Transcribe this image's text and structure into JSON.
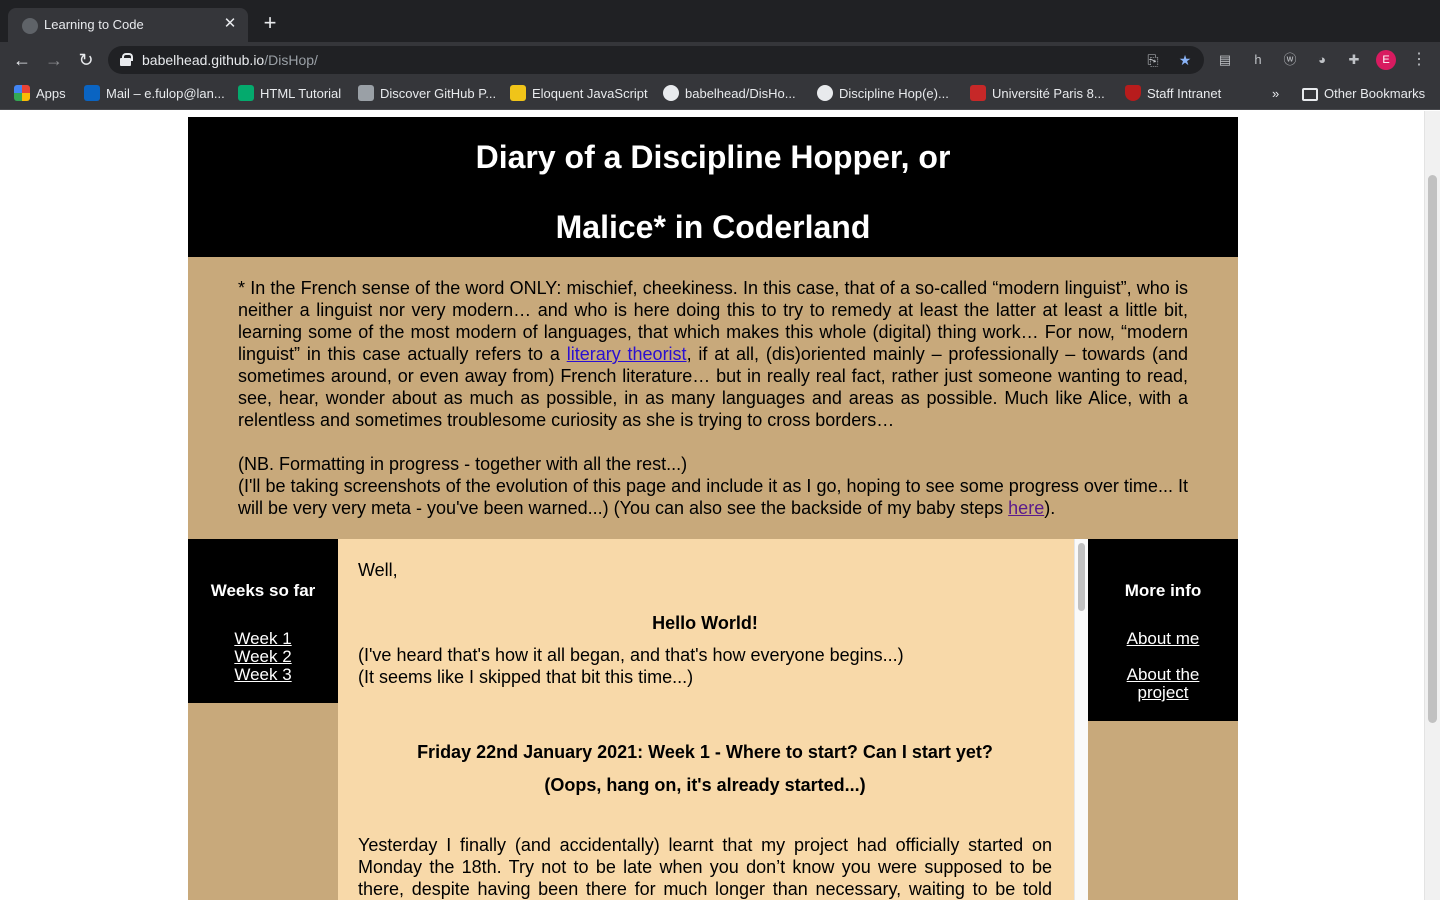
{
  "browser": {
    "tab_title": "Learning to Code",
    "url_host": "babelhead.github.io",
    "url_path": "/DisHop/",
    "profile_initial": "E",
    "bookmarks": [
      {
        "label": "Apps",
        "icon": "apps-grid-icon"
      },
      {
        "label": "Mail – e.fulop@lan...",
        "icon": "outlook-icon"
      },
      {
        "label": "HTML Tutorial",
        "icon": "w3schools-icon"
      },
      {
        "label": "Discover GitHub P...",
        "icon": "page-icon"
      },
      {
        "label": "Eloquent JavaScript",
        "icon": "ejs-icon"
      },
      {
        "label": "babelhead/DisHo...",
        "icon": "github-icon"
      },
      {
        "label": "Discipline Hop(e)...",
        "icon": "globe-icon"
      },
      {
        "label": "Université Paris 8...",
        "icon": "paris8-icon"
      },
      {
        "label": "Staff Intranet",
        "icon": "shield-crest-icon"
      }
    ],
    "overflow_label": "»",
    "other_bookmarks": "Other Bookmarks"
  },
  "site": {
    "title_line1": "Diary of a Discipline Hopper, or",
    "title_line2": "Malice* in Coderland",
    "intro": {
      "p1_before_link": "* In the French sense of the word ONLY: mischief, cheekiness. In this case, that of a so-called “modern linguist”, who is neither a linguist nor very modern… and who is here doing this to try to remedy at least the latter at least a little bit, learning some of the most modern of languages, that which makes this whole (digital) thing work… For now, “modern linguist” in this case actually refers to a ",
      "p1_link": "literary theorist",
      "p1_after_link": ", if at all, (dis)oriented mainly – professionally – towards (and sometimes around, or even away from) French literature… but in really real fact, rather just someone wanting to read, see, hear, wonder about as much as possible, in as many languages and areas as possible. Much like Alice, with a relentless and sometimes troublesome curiosity as she is trying to cross borders…",
      "nb": "(NB. Formatting in progress - together with all the rest...)",
      "p3_before_link": "(I'll be taking screenshots of the evolution of this page and include it as I go, hoping to see some progress over time... It will be very very meta - you've been warned...) (You can also see the backside of my baby steps ",
      "p3_link": "here",
      "p3_after_link": ")."
    },
    "left_nav": {
      "heading": "Weeks so far",
      "links": [
        "Week 1",
        "Week 2",
        "Week 3"
      ]
    },
    "right_nav": {
      "heading": "More info",
      "about_me": "About me",
      "about_project_line1": "About the",
      "about_project_line2": "project"
    },
    "main": {
      "greeting": "Well,",
      "hello": "Hello World!",
      "line1": "(I've heard that's how it all began, and that's how everyone begins...)",
      "line2": "(It seems like I skipped that bit this time...)",
      "entry_title": "Friday 22nd January 2021: Week 1 - Where to start? Can I start yet?",
      "entry_subtitle": "(Oops, hang on, it's already started...)",
      "para1_line1": "Yesterday I finally (and accidentally) learnt that my project had officially started on",
      "para1_line2": "Monday the 18th. Try not to be late when you don’t know you were supposed to be",
      "para1_line3": "there, despite having been there for much longer than necessary, waiting to be told"
    }
  }
}
